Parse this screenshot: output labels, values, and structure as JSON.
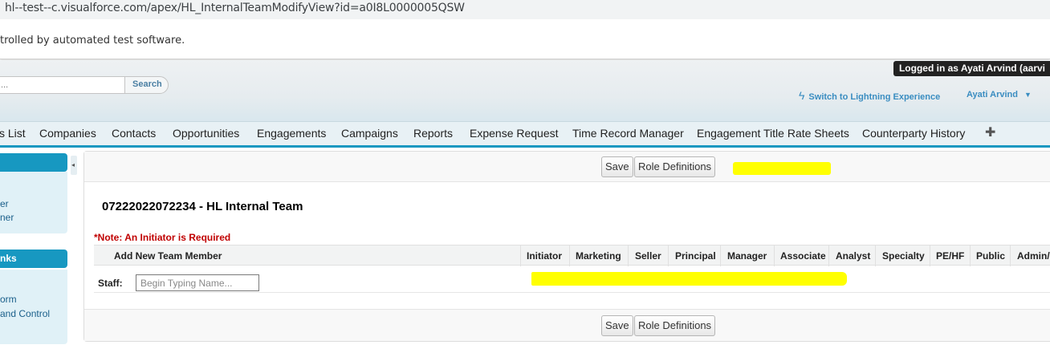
{
  "browser": {
    "url": "hl--test--c.visualforce.com/apex/HL_InternalTeamModifyView?id=a0I8L0000005QSW",
    "infobar_text": "trolled by automated test software."
  },
  "header": {
    "logged_in_text": "Logged in as Ayati Arvind (aarvi",
    "search_placeholder": "...",
    "search_button": "Search",
    "switch_lightning": "Switch to Lightning Experience",
    "switch_icon": "lightning-bolt-icon",
    "user_name": "Ayati Arvind",
    "user_caret": "▼"
  },
  "tabs": [
    {
      "label": "s List"
    },
    {
      "label": "Companies"
    },
    {
      "label": "Contacts"
    },
    {
      "label": "Opportunities"
    },
    {
      "label": "Engagements"
    },
    {
      "label": "Campaigns"
    },
    {
      "label": "Reports"
    },
    {
      "label": "Expense Request"
    },
    {
      "label": "Time Record Manager"
    },
    {
      "label": "Engagement Title Rate Sheets"
    },
    {
      "label": "Counterparty History"
    }
  ],
  "tab_add": "✚",
  "sidebar": {
    "section1_title": "",
    "section1_links": [
      "er",
      "ner"
    ],
    "section2_title": "nks",
    "section2_links": [
      "orm",
      " and Control"
    ],
    "collapse_arrow": "◂"
  },
  "toolbar": {
    "save_label": "Save",
    "role_definitions_label": "Role Definitions"
  },
  "page": {
    "title": "07222022072234 - HL Internal Team",
    "note": "*Note: An Initiator is Required"
  },
  "grid": {
    "add_member_header": "Add New Team Member",
    "columns": [
      "Initiator",
      "Marketing",
      "Seller",
      "Principal",
      "Manager",
      "Associate",
      "Analyst",
      "Specialty",
      "PE/HF",
      "Public",
      "Admin/"
    ],
    "staff_label": "Staff:",
    "staff_placeholder": "Begin Typing Name..."
  },
  "colors": {
    "accent": "#1798c1",
    "link": "#3a8dc1",
    "note_red": "#c00000",
    "highlight": "#ffff00"
  }
}
